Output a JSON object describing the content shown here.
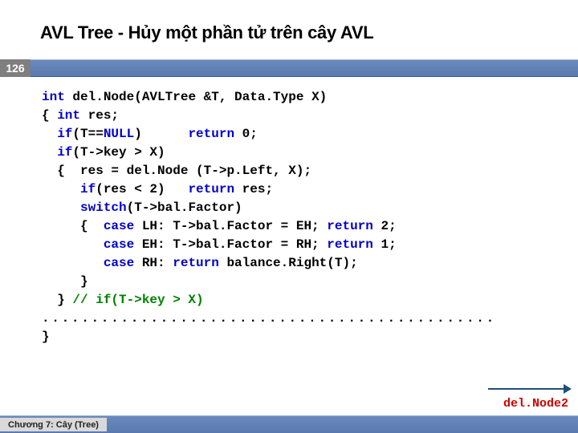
{
  "title": "AVL Tree - Hủy một phần tử trên cây AVL",
  "page_number": "126",
  "code": {
    "l1a": "int",
    "l1b": " del.Node(AVLTree &T, Data.Type X)",
    "l2a": "{ ",
    "l2b": "int",
    "l2c": " res;",
    "l3a": "  ",
    "l3b": "if",
    "l3c": "(T==",
    "l3d": "NULL",
    "l3e": ")      ",
    "l3f": "return",
    "l3g": " 0;",
    "l4a": "  ",
    "l4b": "if",
    "l4c": "(T->key > X)",
    "l5": "  {  res = del.Node (T->p.Left, X);",
    "l6a": "     ",
    "l6b": "if",
    "l6c": "(res < 2)   ",
    "l6d": "return",
    "l6e": " res;",
    "l7a": "     ",
    "l7b": "switch",
    "l7c": "(T->bal.Factor)",
    "l8a": "     {  ",
    "l8b": "case",
    "l8c": " LH: T->bal.Factor = EH; ",
    "l8d": "return",
    "l8e": " 2;",
    "l9a": "        ",
    "l9b": "case",
    "l9c": " EH: T->bal.Factor = RH; ",
    "l9d": "return",
    "l9e": " 1;",
    "l10a": "        ",
    "l10b": "case",
    "l10c": " RH: ",
    "l10d": "return",
    "l10e": " balance.Right(T);",
    "l11": "     }",
    "l12a": "  } ",
    "l12b": "// if(T->key > X)"
  },
  "dots": "..............................................",
  "close_brace": "}",
  "link_label": "del.Node2",
  "footer": "Chương 7: Cây (Tree)"
}
